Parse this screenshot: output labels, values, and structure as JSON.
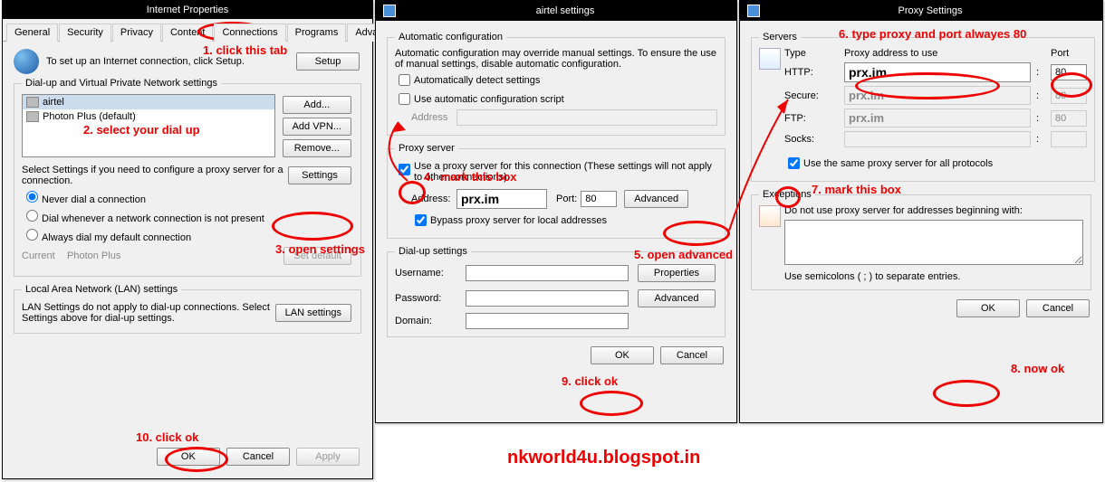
{
  "watermark": "nkworld4u.blogspot.in",
  "annotations": {
    "a1": "1. click this tab",
    "a2": "2. select your dial up",
    "a3": "3. open settings",
    "a4": "4.",
    "a4b": "mark this box",
    "a5": "5. open advanced",
    "a6": "6.  type proxy  and port alwayes 80",
    "a7": "7.  mark this box",
    "a8": "8. now ok",
    "a9": "9. click ok",
    "a10": "10. click ok"
  },
  "dlg1": {
    "title": "Internet Properties",
    "tabs": [
      "General",
      "Security",
      "Privacy",
      "Content",
      "Connections",
      "Programs",
      "Advanced"
    ],
    "setup_text": "To set up an Internet connection, click Setup.",
    "setup_btn": "Setup",
    "dialup_legend": "Dial-up and Virtual Private Network settings",
    "items": [
      {
        "label": "airtel",
        "selected": true
      },
      {
        "label": "Photon Plus (default)",
        "selected": false
      }
    ],
    "btn_add": "Add...",
    "btn_addvpn": "Add VPN...",
    "btn_remove": "Remove...",
    "settings_text": "Select Settings if you need to configure a proxy server for a connection.",
    "btn_settings": "Settings",
    "r1": "Never dial a connection",
    "r2": "Dial whenever a network connection is not present",
    "r3": "Always dial my default connection",
    "current_lbl": "Current",
    "current_val": "Photon Plus",
    "btn_setdef": "Set default",
    "lan_legend": "Local Area Network (LAN) settings",
    "lan_text": "LAN Settings do not apply to dial-up connections. Select Settings above for dial-up settings.",
    "btn_lan": "LAN settings",
    "ok": "OK",
    "cancel": "Cancel",
    "apply": "Apply"
  },
  "dlg2": {
    "title": "airtel settings",
    "auto_legend": "Automatic configuration",
    "auto_text": "Automatic configuration may override manual settings.  To ensure the use of manual settings, disable automatic configuration.",
    "auto_detect": "Automatically detect settings",
    "auto_script": "Use automatic configuration script",
    "addr_lbl": "Address",
    "proxy_legend": "Proxy server",
    "use_proxy": "Use a proxy server for this connection (These settings will not apply to other connections).",
    "addr2_lbl": "Address:",
    "addr2_val": "prx.im",
    "port_lbl": "Port:",
    "port_val": "80",
    "btn_adv": "Advanced",
    "bypass_local": "Bypass proxy server for local addresses",
    "dial_legend": "Dial-up settings",
    "user_lbl": "Username:",
    "pass_lbl": "Password:",
    "dom_lbl": "Domain:",
    "btn_props": "Properties",
    "btn_adv2": "Advanced",
    "ok": "OK",
    "cancel": "Cancel"
  },
  "dlg3": {
    "title": "Proxy Settings",
    "servers_legend": "Servers",
    "h_type": "Type",
    "h_addr": "Proxy address to use",
    "h_port": "Port",
    "rows": [
      {
        "type": "HTTP:",
        "addr": "prx.im",
        "port": "80"
      },
      {
        "type": "Secure:",
        "addr": "prx.im",
        "port": "80"
      },
      {
        "type": "FTP:",
        "addr": "prx.im",
        "port": "80"
      },
      {
        "type": "Socks:",
        "addr": "",
        "port": ""
      }
    ],
    "same_proxy": "Use the same proxy server for all protocols",
    "exc_legend": "Exceptions",
    "exc_text": "Do not use proxy server for addresses beginning with:",
    "exc_hint": "Use semicolons ( ; ) to separate entries.",
    "ok": "OK",
    "cancel": "Cancel"
  }
}
